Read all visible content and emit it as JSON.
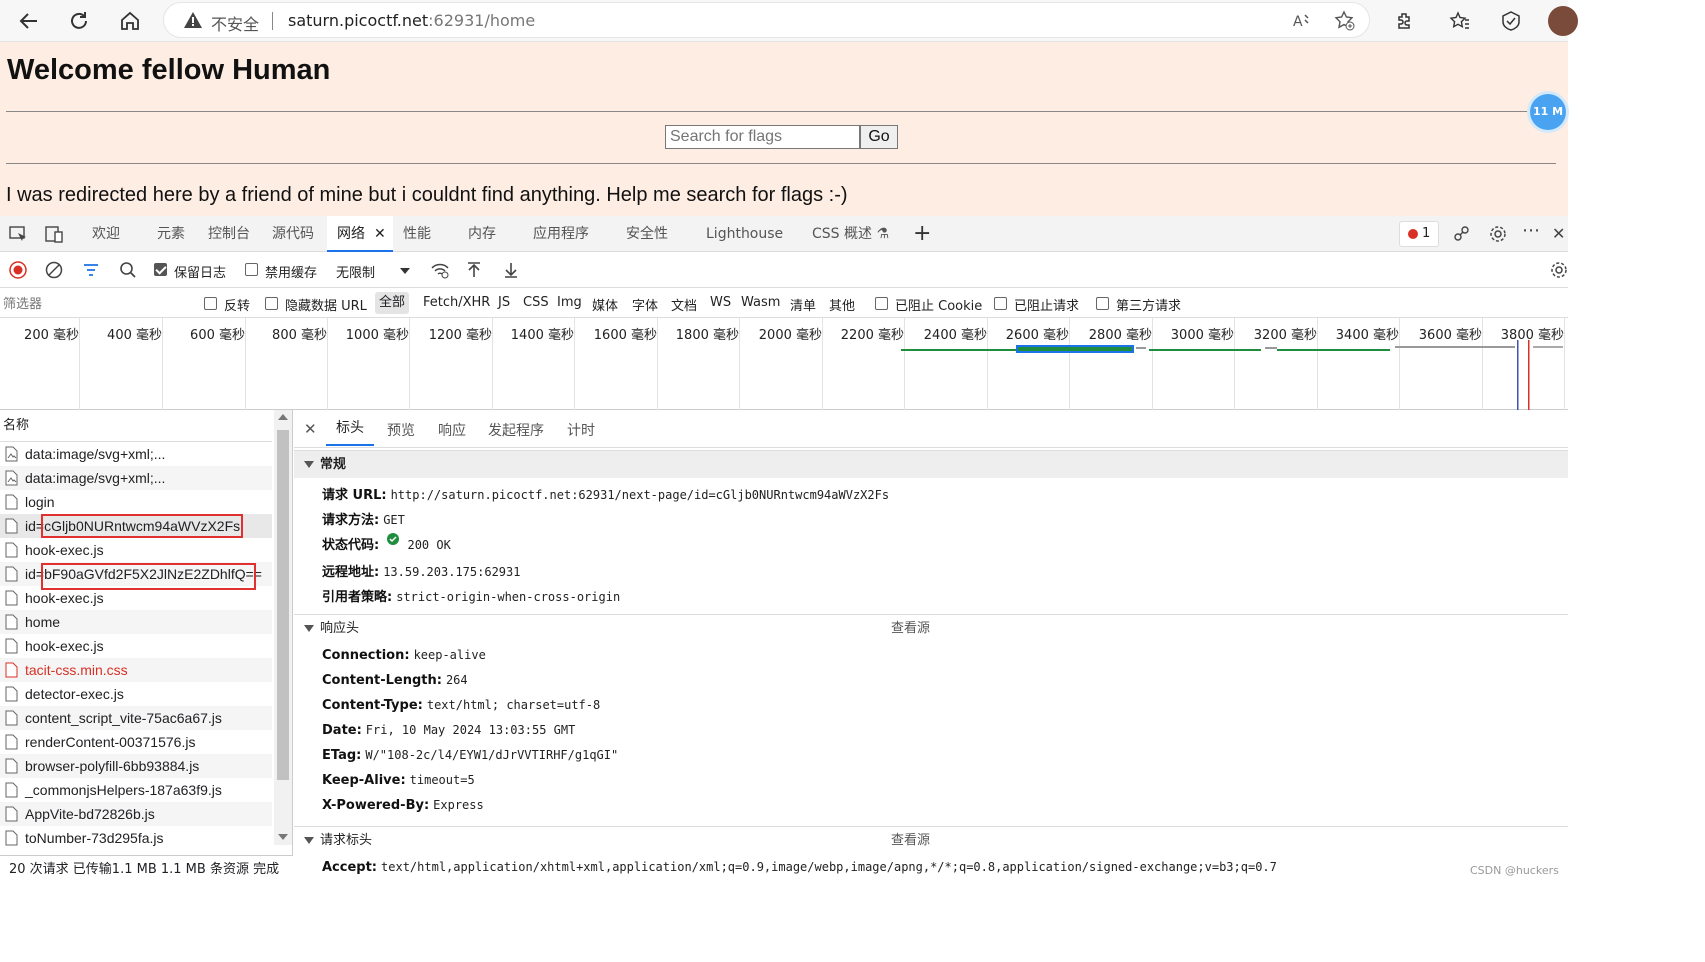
{
  "browser": {
    "insecure_label": "不安全",
    "url_host": "saturn.picoctf.net",
    "url_rest": ":62931/home"
  },
  "page": {
    "title": "Welcome fellow Human",
    "search_placeholder": "Search for flags",
    "go_label": "Go",
    "message": "I was redirected here by a friend of mine but i couldnt find anything. Help me search for flags :-)",
    "badge": "11 M"
  },
  "devtools": {
    "tabs": [
      "欢迎",
      "元素",
      "控制台",
      "源代码",
      "网络",
      "性能",
      "内存",
      "应用程序",
      "安全性",
      "Lighthouse",
      "CSS 概述"
    ],
    "active_tab": "网络",
    "error_count": "1",
    "toolbar": {
      "preserve_log": "保留日志",
      "disable_cache": "禁用缓存",
      "throttle": "无限制"
    },
    "filter": {
      "placeholder": "筛选器",
      "invert": "反转",
      "hide_data_urls": "隐藏数据 URL",
      "all": "全部",
      "types": [
        "Fetch/XHR",
        "JS",
        "CSS",
        "Img",
        "媒体",
        "字体",
        "文档",
        "WS",
        "Wasm",
        "清单",
        "其他"
      ],
      "blocked_cookies": "已阻止 Cookie",
      "blocked_requests": "已阻止请求",
      "third_party": "第三方请求"
    },
    "timeline_ticks": [
      "200 毫秒",
      "400 毫秒",
      "600 毫秒",
      "800 毫秒",
      "1000 毫秒",
      "1200 毫秒",
      "1400 毫秒",
      "1600 毫秒",
      "1800 毫秒",
      "2000 毫秒",
      "2200 毫秒",
      "2400 毫秒",
      "2600 毫秒",
      "2800 毫秒",
      "3000 毫秒",
      "3200 毫秒",
      "3400 毫秒",
      "3600 毫秒",
      "3800 毫秒"
    ],
    "list_header": "名称",
    "requests": [
      {
        "name": "data:image/svg+xml;..."
      },
      {
        "name": "data:image/svg+xml;..."
      },
      {
        "name": "login"
      },
      {
        "name": "id=cGljb0NURntwcm94aWVzX2Fs"
      },
      {
        "name": "hook-exec.js"
      },
      {
        "name": "id=bF90aGVfd2F5X2JlNzE2ZDhlfQ=="
      },
      {
        "name": "hook-exec.js"
      },
      {
        "name": "home"
      },
      {
        "name": "hook-exec.js"
      },
      {
        "name": "tacit-css.min.css"
      },
      {
        "name": "detector-exec.js"
      },
      {
        "name": "content_script_vite-75ac6a67.js"
      },
      {
        "name": "renderContent-00371576.js"
      },
      {
        "name": "browser-polyfill-6bb93884.js"
      },
      {
        "name": "_commonjsHelpers-187a63f9.js"
      },
      {
        "name": "AppVite-bd72826b.js"
      },
      {
        "name": "toNumber-73d295fa.js"
      }
    ],
    "status": "20 次请求 已传输1.1 MB 1.1 MB 条资源 完成",
    "detail_tabs": [
      "标头",
      "预览",
      "响应",
      "发起程序",
      "计时"
    ],
    "general": {
      "title": "常规",
      "url_label": "请求 URL:",
      "url": "http://saturn.picoctf.net:62931/next-page/id=cGljb0NURntwcm94aWVzX2Fs",
      "method_label": "请求方法:",
      "method": "GET",
      "status_label": "状态代码:",
      "status": "200 OK",
      "remote_label": "远程地址:",
      "remote": "13.59.203.175:62931",
      "referrer_label": "引用者策略:",
      "referrer": "strict-origin-when-cross-origin"
    },
    "response_headers": {
      "title": "响应头",
      "view_source": "查看源",
      "items": [
        {
          "k": "Connection:",
          "v": "keep-alive"
        },
        {
          "k": "Content-Length:",
          "v": "264"
        },
        {
          "k": "Content-Type:",
          "v": "text/html; charset=utf-8"
        },
        {
          "k": "Date:",
          "v": "Fri, 10 May 2024 13:03:55 GMT"
        },
        {
          "k": "ETag:",
          "v": "W/\"108-2c/l4/EYW1/dJrVVTIRHF/g1qGI\""
        },
        {
          "k": "Keep-Alive:",
          "v": "timeout=5"
        },
        {
          "k": "X-Powered-By:",
          "v": "Express"
        }
      ]
    },
    "request_headers": {
      "title": "请求标头",
      "view_source": "查看源",
      "accept_label": "Accept:",
      "accept": "text/html,application/xhtml+xml,application/xml;q=0.9,image/webp,image/apng,*/*;q=0.8,application/signed-exchange;v=b3;q=0.7"
    }
  },
  "watermark": "CSDN @huckers",
  "colors": {
    "accent": "#1a73e8",
    "page_bg": "#fdede3",
    "highlight": "#e03030"
  }
}
